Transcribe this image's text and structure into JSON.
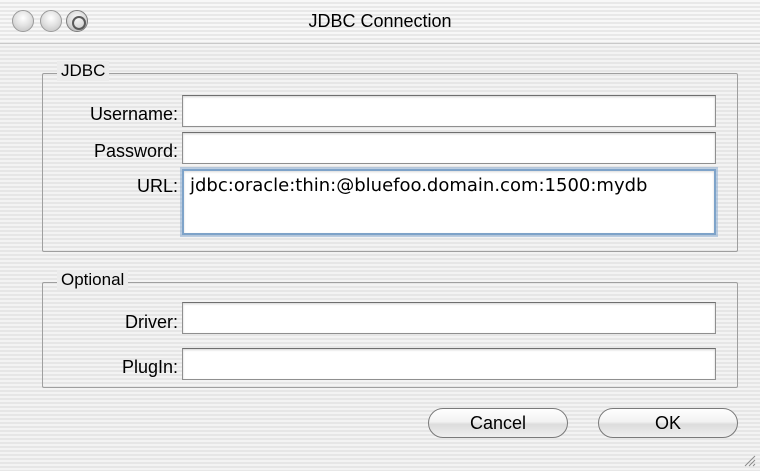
{
  "window": {
    "title": "JDBC Connection"
  },
  "jdbc_group": {
    "label": "JDBC",
    "username": {
      "label": "Username:",
      "value": ""
    },
    "password": {
      "label": "Password:",
      "value": ""
    },
    "url": {
      "label": "URL:",
      "value": "jdbc:oracle:thin:@bluefoo.domain.com:1500:mydb"
    }
  },
  "optional_group": {
    "label": "Optional",
    "driver": {
      "label": "Driver:",
      "value": ""
    },
    "plugin": {
      "label": "PlugIn:",
      "value": ""
    }
  },
  "buttons": {
    "cancel": "Cancel",
    "ok": "OK"
  }
}
